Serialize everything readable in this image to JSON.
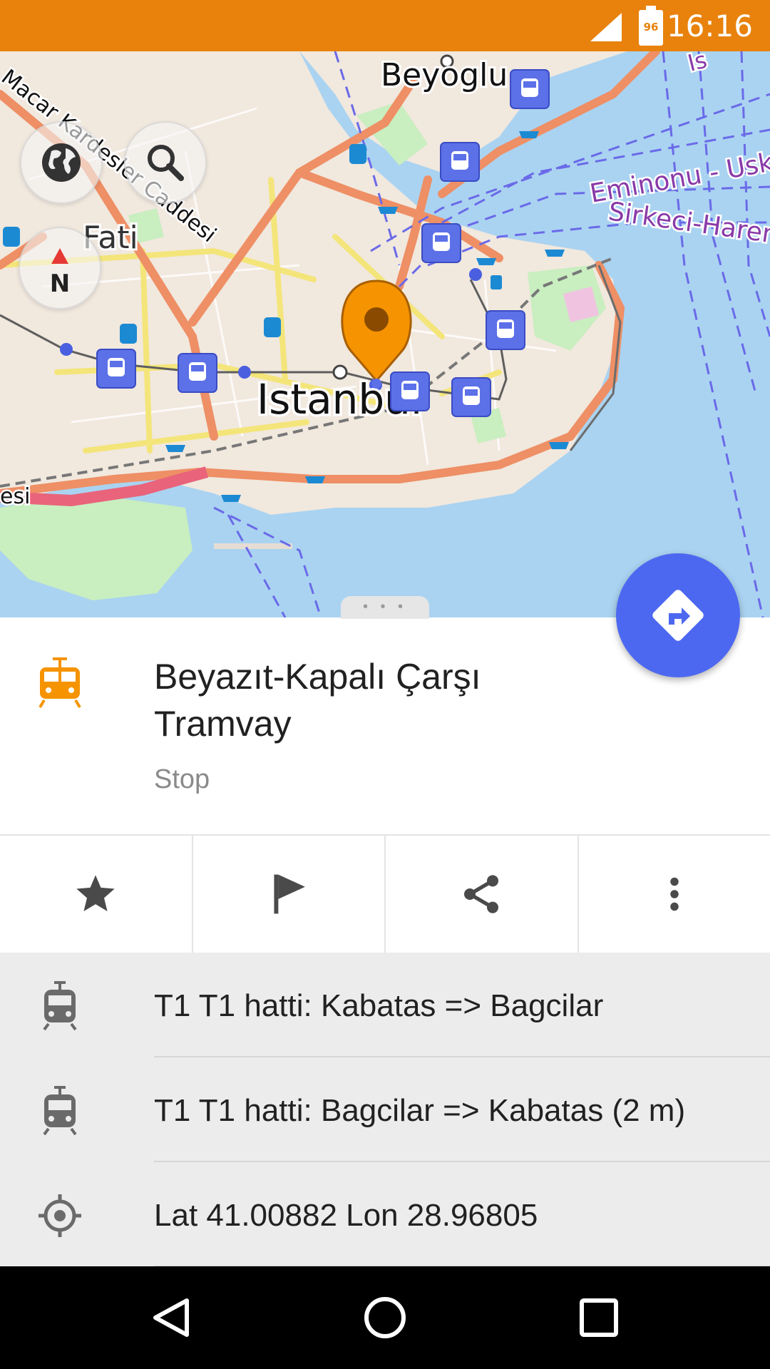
{
  "status_bar": {
    "time": "16:16",
    "battery_level": "96",
    "signal_icon": "cell-signal-icon",
    "battery_icon": "battery-icon"
  },
  "map": {
    "labels": {
      "beyoglu": "Beyoglu",
      "istanbul": "Istanbul",
      "fatih": "Fati",
      "street_macar": "Macar Kardesler Caddesi",
      "ferry_eminonu": "Eminonu - Usk",
      "ferry_sirkeci": "Sirkeci-Harem",
      "street_left": "esi",
      "street_top_right": "Is"
    },
    "controls": {
      "globe_icon": "globe-icon",
      "search_icon": "search-icon",
      "compass_label": "N",
      "directions_icon": "directions-icon"
    },
    "colors": {
      "water": "#aad3f1",
      "land": "#f1e8de",
      "major_road": "#ee8f65",
      "secondary_road": "#f4e57a",
      "park": "#c9eec0",
      "transit_badge": "#5c70e8",
      "marker": "#f59400"
    }
  },
  "place": {
    "title": "Beyazıt-Kapalı Çarşı Tramvay",
    "type": "Stop",
    "icon": "tram-icon"
  },
  "actions": [
    {
      "name": "favorite",
      "icon": "star-icon"
    },
    {
      "name": "mark",
      "icon": "flag-icon"
    },
    {
      "name": "share",
      "icon": "share-icon"
    },
    {
      "name": "more",
      "icon": "more-vert-icon"
    }
  ],
  "details": [
    {
      "icon": "tram-route-icon",
      "text": "T1 T1 hatti: Kabatas => Bagcilar"
    },
    {
      "icon": "tram-route-icon",
      "text": "T1 T1 hatti: Bagcilar => Kabatas (2 m)"
    },
    {
      "icon": "location-icon",
      "text": "Lat 41.00882 Lon 28.96805"
    }
  ],
  "nav_bar": {
    "back_icon": "back-icon",
    "home_icon": "home-icon",
    "recents_icon": "recents-icon"
  }
}
